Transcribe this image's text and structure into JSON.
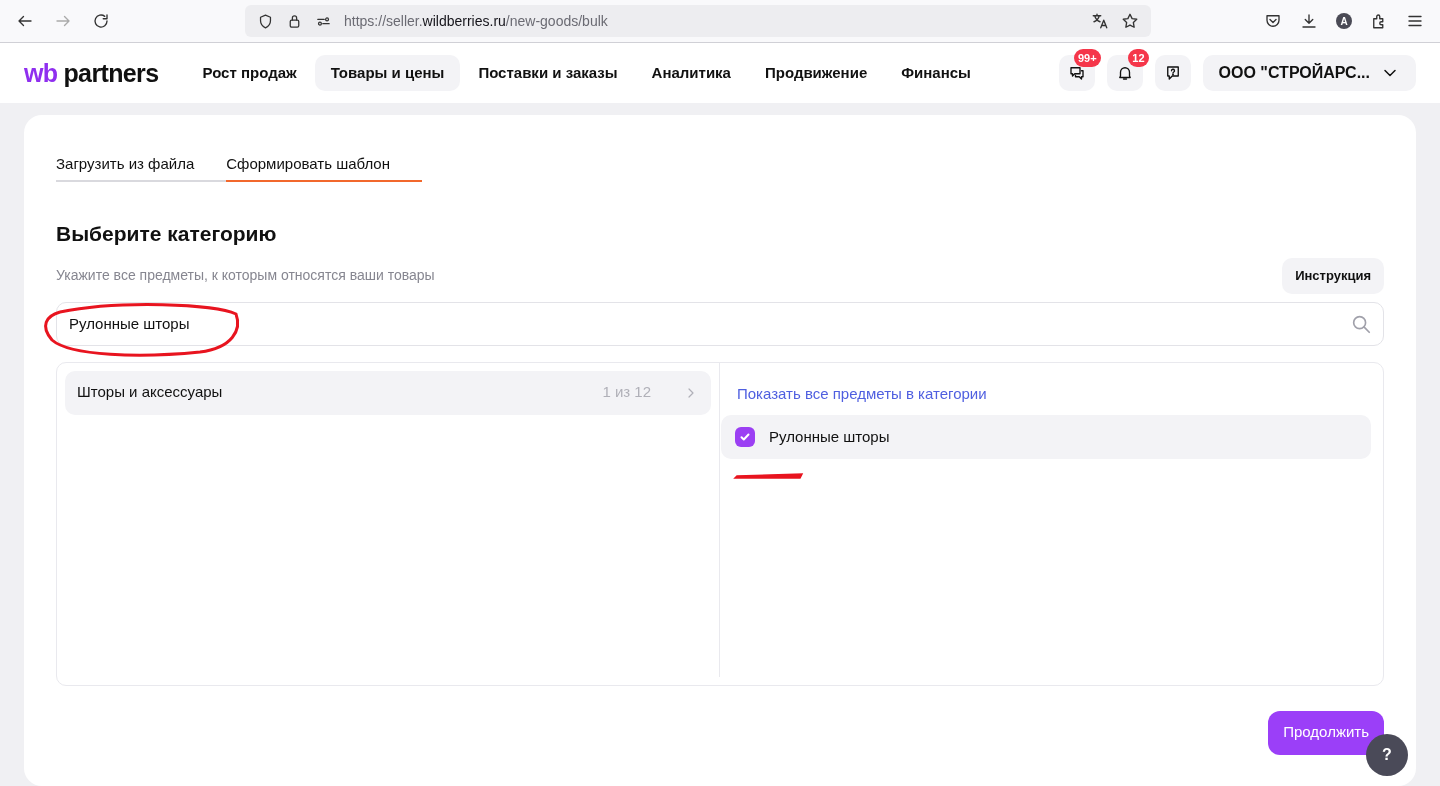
{
  "browser": {
    "url_prefix": "https://seller.",
    "url_domain": "wildberries.ru",
    "url_path": "/new-goods/bulk",
    "profile_initial": "A"
  },
  "header": {
    "logo_mark": "wb",
    "logo_text": "partners",
    "nav": [
      {
        "label": "Рост продаж",
        "selected": false
      },
      {
        "label": "Товары и цены",
        "selected": true
      },
      {
        "label": "Поставки и заказы",
        "selected": false
      },
      {
        "label": "Аналитика",
        "selected": false
      },
      {
        "label": "Продвижение",
        "selected": false
      },
      {
        "label": "Финансы",
        "selected": false
      }
    ],
    "icons": [
      {
        "kind": "chat",
        "badge": "99+"
      },
      {
        "kind": "bell",
        "badge": "12"
      },
      {
        "kind": "help"
      }
    ],
    "account": "ООО \"СТРОЙАРС..."
  },
  "tabs": [
    {
      "label": "Загрузить из файла",
      "selected": false
    },
    {
      "label": "Сформировать шаблон",
      "selected": true
    }
  ],
  "heading": "Выберите категорию",
  "subtitle": "Укажите все предметы, к которым относятся ваши товары",
  "instruction_button": "Инструкция",
  "search": {
    "value": "Рулонные шторы"
  },
  "categories": [
    {
      "name": "Шторы и аксессуары",
      "count": "1 из 12",
      "selected": true
    }
  ],
  "show_all_link": "Показать все предметы в категории",
  "items": [
    {
      "label": "Рулонные шторы",
      "checked": true
    }
  ],
  "continue_button": "Продолжить",
  "help_button": "?"
}
